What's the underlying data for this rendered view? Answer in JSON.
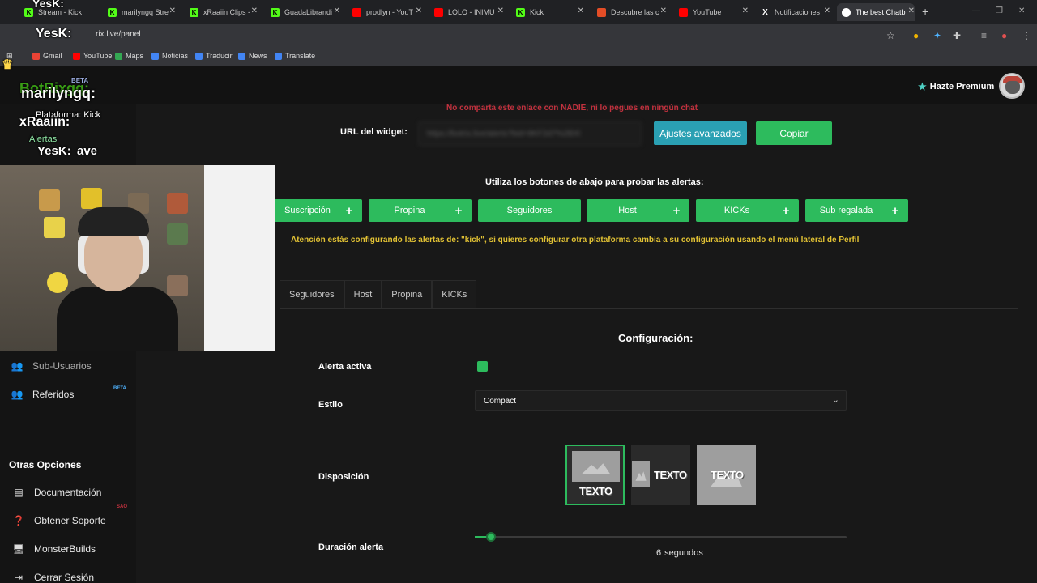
{
  "browser": {
    "tabs": [
      {
        "label": "Stream - Kick",
        "color": "#53fc18"
      },
      {
        "label": "marilyngq Stre",
        "color": "#53fc18"
      },
      {
        "label": "xRaaiin Clips -",
        "color": "#53fc18"
      },
      {
        "label": "GuadaLibrandi",
        "color": "#53fc18"
      },
      {
        "label": "prodlyn - YouT",
        "color": "#ff0000"
      },
      {
        "label": "LOLO - INIMU",
        "color": "#ff0000"
      },
      {
        "label": "Kick",
        "color": "#53fc18"
      },
      {
        "label": "Descubre las c",
        "color": "#e44d26"
      },
      {
        "label": "YouTube",
        "color": "#ff0000"
      },
      {
        "label": "Notificaciones",
        "color": "#ffffff"
      },
      {
        "label": "The best Chatb",
        "color": "#ffffff"
      }
    ],
    "url": "rix.live/panel",
    "bookmarks": [
      "Gmail",
      "YouTube",
      "Maps",
      "Noticias",
      "Traducir",
      "News",
      "Translate"
    ]
  },
  "header": {
    "premium_label": "Hazte Premium"
  },
  "widget": {
    "warning": "No comparta este enlace con NADIE, ni lo pegues en ningún chat",
    "url_label": "URL del widget:",
    "url_value": "https://botrix.live/alerts?bid=9KF2d7%2BXl",
    "advanced_button": "Ajustes avanzados",
    "copy_button": "Copiar",
    "test_instructions": "Utiliza los botones de abajo para probar las alertas:",
    "test_buttons": [
      "Suscripción",
      "Propina",
      "Seguidores",
      "Host",
      "KICKs",
      "Sub regalada"
    ],
    "platform_note": "Atención estás configurando las alertas de: \"kick\", si quieres configurar otra plataforma cambia a su configuración usando el menú lateral de Perfil"
  },
  "alert_tabs": [
    "Seguidores",
    "Host",
    "Propina",
    "KICKs"
  ],
  "config": {
    "title": "Configuración:",
    "active_label": "Alerta activa",
    "active_value": true,
    "style_label": "Estilo",
    "style_value": "Compact",
    "layout_label": "Disposición",
    "layout_options": [
      "TEXTO",
      "TEXTO",
      "TEXTO"
    ],
    "layout_selected": 0,
    "duration_label": "Duración alerta",
    "duration_value": "6",
    "duration_unit": "segundos",
    "duration_fraction": 0.04
  },
  "sidebar": {
    "items_top": [
      {
        "label": "Sub-Usuarios",
        "icon": "users-icon"
      },
      {
        "label": "Referidos",
        "icon": "people-icon",
        "badge": "BETA"
      }
    ],
    "section_title": "Otras Opciones",
    "items_bottom": [
      {
        "label": "Documentación",
        "icon": "document-icon"
      },
      {
        "label": "Obtener Soporte",
        "icon": "help-icon"
      },
      {
        "label": "MonsterBuilds",
        "icon": "computer-icon",
        "badge": "SAO"
      },
      {
        "label": "Cerrar Sesión",
        "icon": "logout-icon"
      }
    ]
  },
  "overlay": {
    "chat": [
      {
        "user": "YesK:",
        "text": ""
      },
      {
        "user": "YesK:",
        "text": ""
      },
      {
        "user": "BotRixgq:",
        "text": "marilyngq:",
        "badge": "BETA"
      },
      {
        "user": "",
        "text": "Plataforma: Kick"
      },
      {
        "user": "xRaaiin:",
        "text": ""
      },
      {
        "user": "",
        "text": "Alertas"
      },
      {
        "user": "YesK:",
        "text": "ave"
      }
    ]
  }
}
